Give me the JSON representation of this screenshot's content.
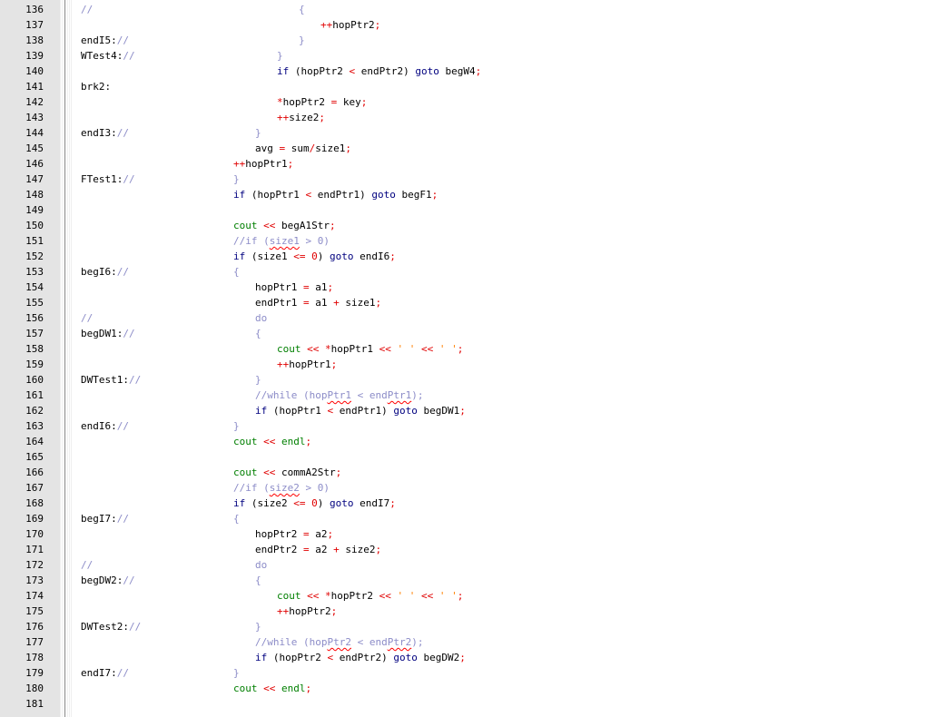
{
  "colors": {
    "keyword": "#00007f",
    "identifier": "#000000",
    "operator": "#e00000",
    "comment": "#8c8cc8",
    "string": "#ff8000",
    "type": "#007f00",
    "linenumber": "#000000"
  },
  "lines": [
    {
      "n": "136",
      "label": [
        {
          "t": "//",
          "c": "comment"
        }
      ],
      "indent": 10,
      "code": [
        {
          "t": "{",
          "c": "comment"
        }
      ]
    },
    {
      "n": "137",
      "label": [],
      "indent": 11,
      "code": [
        {
          "t": "++",
          "c": "operator"
        },
        {
          "t": "hopPtr2",
          "c": "identifier"
        },
        {
          "t": ";",
          "c": "operator"
        }
      ]
    },
    {
      "n": "138",
      "label": [
        {
          "t": "endI5:",
          "c": "identifier"
        },
        {
          "t": "//",
          "c": "comment"
        }
      ],
      "indent": 10,
      "code": [
        {
          "t": "}",
          "c": "comment"
        }
      ]
    },
    {
      "n": "139",
      "label": [
        {
          "t": "WTest4:",
          "c": "identifier"
        },
        {
          "t": "//",
          "c": "comment"
        }
      ],
      "indent": 9,
      "code": [
        {
          "t": "}",
          "c": "comment"
        }
      ]
    },
    {
      "n": "140",
      "label": [],
      "indent": 9,
      "code": [
        {
          "t": "if",
          "c": "keyword"
        },
        {
          "t": " (hopPtr2 ",
          "c": "identifier"
        },
        {
          "t": "<",
          "c": "operator"
        },
        {
          "t": " endPtr2) ",
          "c": "identifier"
        },
        {
          "t": "goto",
          "c": "keyword"
        },
        {
          "t": " begW4",
          "c": "identifier"
        },
        {
          "t": ";",
          "c": "operator"
        }
      ]
    },
    {
      "n": "141",
      "label": [
        {
          "t": "brk2:",
          "c": "identifier"
        }
      ],
      "indent": 9,
      "code": []
    },
    {
      "n": "142",
      "label": [],
      "indent": 9,
      "code": [
        {
          "t": "*",
          "c": "operator"
        },
        {
          "t": "hopPtr2 ",
          "c": "identifier"
        },
        {
          "t": "=",
          "c": "operator"
        },
        {
          "t": " key",
          "c": "identifier"
        },
        {
          "t": ";",
          "c": "operator"
        }
      ]
    },
    {
      "n": "143",
      "label": [],
      "indent": 9,
      "code": [
        {
          "t": "++",
          "c": "operator"
        },
        {
          "t": "size2",
          "c": "identifier"
        },
        {
          "t": ";",
          "c": "operator"
        }
      ]
    },
    {
      "n": "144",
      "label": [
        {
          "t": "endI3:",
          "c": "identifier"
        },
        {
          "t": "//",
          "c": "comment"
        }
      ],
      "indent": 8,
      "code": [
        {
          "t": "}",
          "c": "comment"
        }
      ]
    },
    {
      "n": "145",
      "label": [],
      "indent": 8,
      "code": [
        {
          "t": "avg ",
          "c": "identifier"
        },
        {
          "t": "=",
          "c": "operator"
        },
        {
          "t": " sum",
          "c": "identifier"
        },
        {
          "t": "/",
          "c": "operator"
        },
        {
          "t": "size1",
          "c": "identifier"
        },
        {
          "t": ";",
          "c": "operator"
        }
      ]
    },
    {
      "n": "146",
      "label": [],
      "indent": 7,
      "code": [
        {
          "t": "++",
          "c": "operator"
        },
        {
          "t": "hopPtr1",
          "c": "identifier"
        },
        {
          "t": ";",
          "c": "operator"
        }
      ]
    },
    {
      "n": "147",
      "label": [
        {
          "t": "FTest1:",
          "c": "identifier"
        },
        {
          "t": "//",
          "c": "comment"
        }
      ],
      "indent": 7,
      "code": [
        {
          "t": "}",
          "c": "comment"
        }
      ]
    },
    {
      "n": "148",
      "label": [],
      "indent": 7,
      "code": [
        {
          "t": "if",
          "c": "keyword"
        },
        {
          "t": " (hopPtr1 ",
          "c": "identifier"
        },
        {
          "t": "<",
          "c": "operator"
        },
        {
          "t": " endPtr1) ",
          "c": "identifier"
        },
        {
          "t": "goto",
          "c": "keyword"
        },
        {
          "t": " begF1",
          "c": "identifier"
        },
        {
          "t": ";",
          "c": "operator"
        }
      ]
    },
    {
      "n": "149",
      "label": [],
      "indent": 7,
      "code": []
    },
    {
      "n": "150",
      "label": [],
      "indent": 7,
      "code": [
        {
          "t": "cout",
          "c": "type"
        },
        {
          "t": " ",
          "c": "identifier"
        },
        {
          "t": "<<",
          "c": "operator"
        },
        {
          "t": " begA1Str",
          "c": "identifier"
        },
        {
          "t": ";",
          "c": "operator"
        }
      ]
    },
    {
      "n": "151",
      "label": [],
      "indent": 7,
      "code": [
        {
          "t": "//if (",
          "c": "comment"
        },
        {
          "t": "size1",
          "c": "comment",
          "sq": true
        },
        {
          "t": " > 0)",
          "c": "comment"
        }
      ]
    },
    {
      "n": "152",
      "label": [],
      "indent": 7,
      "code": [
        {
          "t": "if",
          "c": "keyword"
        },
        {
          "t": " (size1 ",
          "c": "identifier"
        },
        {
          "t": "<=",
          "c": "operator"
        },
        {
          "t": " ",
          "c": "identifier"
        },
        {
          "t": "0",
          "c": "operator"
        },
        {
          "t": ") ",
          "c": "identifier"
        },
        {
          "t": "goto",
          "c": "keyword"
        },
        {
          "t": " endI6",
          "c": "identifier"
        },
        {
          "t": ";",
          "c": "operator"
        }
      ]
    },
    {
      "n": "153",
      "label": [
        {
          "t": "begI6:",
          "c": "identifier"
        },
        {
          "t": "//",
          "c": "comment"
        }
      ],
      "indent": 7,
      "code": [
        {
          "t": "{",
          "c": "comment"
        }
      ]
    },
    {
      "n": "154",
      "label": [],
      "indent": 8,
      "code": [
        {
          "t": "hopPtr1 ",
          "c": "identifier"
        },
        {
          "t": "=",
          "c": "operator"
        },
        {
          "t": " a1",
          "c": "identifier"
        },
        {
          "t": ";",
          "c": "operator"
        }
      ]
    },
    {
      "n": "155",
      "label": [],
      "indent": 8,
      "code": [
        {
          "t": "endPtr1 ",
          "c": "identifier"
        },
        {
          "t": "=",
          "c": "operator"
        },
        {
          "t": " a1 ",
          "c": "identifier"
        },
        {
          "t": "+",
          "c": "operator"
        },
        {
          "t": " size1",
          "c": "identifier"
        },
        {
          "t": ";",
          "c": "operator"
        }
      ]
    },
    {
      "n": "156",
      "label": [
        {
          "t": "//",
          "c": "comment"
        }
      ],
      "indent": 8,
      "code": [
        {
          "t": "do",
          "c": "comment"
        }
      ]
    },
    {
      "n": "157",
      "label": [
        {
          "t": "begDW1:",
          "c": "identifier"
        },
        {
          "t": "//",
          "c": "comment"
        }
      ],
      "indent": 8,
      "code": [
        {
          "t": "{",
          "c": "comment"
        }
      ]
    },
    {
      "n": "158",
      "label": [],
      "indent": 9,
      "code": [
        {
          "t": "cout",
          "c": "type"
        },
        {
          "t": " ",
          "c": "identifier"
        },
        {
          "t": "<<",
          "c": "operator"
        },
        {
          "t": " ",
          "c": "identifier"
        },
        {
          "t": "*",
          "c": "operator"
        },
        {
          "t": "hopPtr1 ",
          "c": "identifier"
        },
        {
          "t": "<<",
          "c": "operator"
        },
        {
          "t": " ",
          "c": "identifier"
        },
        {
          "t": "' '",
          "c": "string"
        },
        {
          "t": " ",
          "c": "identifier"
        },
        {
          "t": "<<",
          "c": "operator"
        },
        {
          "t": " ",
          "c": "identifier"
        },
        {
          "t": "' '",
          "c": "string"
        },
        {
          "t": ";",
          "c": "operator"
        }
      ]
    },
    {
      "n": "159",
      "label": [],
      "indent": 9,
      "code": [
        {
          "t": "++",
          "c": "operator"
        },
        {
          "t": "hopPtr1",
          "c": "identifier"
        },
        {
          "t": ";",
          "c": "operator"
        }
      ]
    },
    {
      "n": "160",
      "label": [
        {
          "t": "DWTest1:",
          "c": "identifier"
        },
        {
          "t": "//",
          "c": "comment"
        }
      ],
      "indent": 8,
      "code": [
        {
          "t": "}",
          "c": "comment"
        }
      ]
    },
    {
      "n": "161",
      "label": [],
      "indent": 8,
      "code": [
        {
          "t": "//while (hop",
          "c": "comment"
        },
        {
          "t": "Ptr1",
          "c": "comment",
          "sq": true
        },
        {
          "t": " < end",
          "c": "comment"
        },
        {
          "t": "Ptr1",
          "c": "comment",
          "sq": true
        },
        {
          "t": ");",
          "c": "comment"
        }
      ]
    },
    {
      "n": "162",
      "label": [],
      "indent": 8,
      "code": [
        {
          "t": "if",
          "c": "keyword"
        },
        {
          "t": " (hopPtr1 ",
          "c": "identifier"
        },
        {
          "t": "<",
          "c": "operator"
        },
        {
          "t": " endPtr1) ",
          "c": "identifier"
        },
        {
          "t": "goto",
          "c": "keyword"
        },
        {
          "t": " begDW1",
          "c": "identifier"
        },
        {
          "t": ";",
          "c": "operator"
        }
      ]
    },
    {
      "n": "163",
      "label": [
        {
          "t": "endI6:",
          "c": "identifier"
        },
        {
          "t": "//",
          "c": "comment"
        }
      ],
      "indent": 7,
      "code": [
        {
          "t": "}",
          "c": "comment"
        }
      ]
    },
    {
      "n": "164",
      "label": [],
      "indent": 7,
      "code": [
        {
          "t": "cout",
          "c": "type"
        },
        {
          "t": " ",
          "c": "identifier"
        },
        {
          "t": "<<",
          "c": "operator"
        },
        {
          "t": " endl",
          "c": "type"
        },
        {
          "t": ";",
          "c": "operator"
        }
      ]
    },
    {
      "n": "165",
      "label": [],
      "indent": 7,
      "code": []
    },
    {
      "n": "166",
      "label": [],
      "indent": 7,
      "code": [
        {
          "t": "cout",
          "c": "type"
        },
        {
          "t": " ",
          "c": "identifier"
        },
        {
          "t": "<<",
          "c": "operator"
        },
        {
          "t": " commA2Str",
          "c": "identifier"
        },
        {
          "t": ";",
          "c": "operator"
        }
      ]
    },
    {
      "n": "167",
      "label": [],
      "indent": 7,
      "code": [
        {
          "t": "//if (",
          "c": "comment"
        },
        {
          "t": "size2",
          "c": "comment",
          "sq": true
        },
        {
          "t": " > 0)",
          "c": "comment"
        }
      ]
    },
    {
      "n": "168",
      "label": [],
      "indent": 7,
      "code": [
        {
          "t": "if",
          "c": "keyword"
        },
        {
          "t": " (size2 ",
          "c": "identifier"
        },
        {
          "t": "<=",
          "c": "operator"
        },
        {
          "t": " ",
          "c": "identifier"
        },
        {
          "t": "0",
          "c": "operator"
        },
        {
          "t": ") ",
          "c": "identifier"
        },
        {
          "t": "goto",
          "c": "keyword"
        },
        {
          "t": " endI7",
          "c": "identifier"
        },
        {
          "t": ";",
          "c": "operator"
        }
      ]
    },
    {
      "n": "169",
      "label": [
        {
          "t": "begI7:",
          "c": "identifier"
        },
        {
          "t": "//",
          "c": "comment"
        }
      ],
      "indent": 7,
      "code": [
        {
          "t": "{",
          "c": "comment"
        }
      ]
    },
    {
      "n": "170",
      "label": [],
      "indent": 8,
      "code": [
        {
          "t": "hopPtr2 ",
          "c": "identifier"
        },
        {
          "t": "=",
          "c": "operator"
        },
        {
          "t": " a2",
          "c": "identifier"
        },
        {
          "t": ";",
          "c": "operator"
        }
      ]
    },
    {
      "n": "171",
      "label": [],
      "indent": 8,
      "code": [
        {
          "t": "endPtr2 ",
          "c": "identifier"
        },
        {
          "t": "=",
          "c": "operator"
        },
        {
          "t": " a2 ",
          "c": "identifier"
        },
        {
          "t": "+",
          "c": "operator"
        },
        {
          "t": " size2",
          "c": "identifier"
        },
        {
          "t": ";",
          "c": "operator"
        }
      ]
    },
    {
      "n": "172",
      "label": [
        {
          "t": "//",
          "c": "comment"
        }
      ],
      "indent": 8,
      "code": [
        {
          "t": "do",
          "c": "comment"
        }
      ]
    },
    {
      "n": "173",
      "label": [
        {
          "t": "begDW2:",
          "c": "identifier"
        },
        {
          "t": "//",
          "c": "comment"
        }
      ],
      "indent": 8,
      "code": [
        {
          "t": "{",
          "c": "comment"
        }
      ]
    },
    {
      "n": "174",
      "label": [],
      "indent": 9,
      "code": [
        {
          "t": "cout",
          "c": "type"
        },
        {
          "t": " ",
          "c": "identifier"
        },
        {
          "t": "<<",
          "c": "operator"
        },
        {
          "t": " ",
          "c": "identifier"
        },
        {
          "t": "*",
          "c": "operator"
        },
        {
          "t": "hopPtr2 ",
          "c": "identifier"
        },
        {
          "t": "<<",
          "c": "operator"
        },
        {
          "t": " ",
          "c": "identifier"
        },
        {
          "t": "' '",
          "c": "string"
        },
        {
          "t": " ",
          "c": "identifier"
        },
        {
          "t": "<<",
          "c": "operator"
        },
        {
          "t": " ",
          "c": "identifier"
        },
        {
          "t": "' '",
          "c": "string"
        },
        {
          "t": ";",
          "c": "operator"
        }
      ]
    },
    {
      "n": "175",
      "label": [],
      "indent": 9,
      "code": [
        {
          "t": "++",
          "c": "operator"
        },
        {
          "t": "hopPtr2",
          "c": "identifier"
        },
        {
          "t": ";",
          "c": "operator"
        }
      ]
    },
    {
      "n": "176",
      "label": [
        {
          "t": "DWTest2:",
          "c": "identifier"
        },
        {
          "t": "//",
          "c": "comment"
        }
      ],
      "indent": 8,
      "code": [
        {
          "t": "}",
          "c": "comment"
        }
      ]
    },
    {
      "n": "177",
      "label": [],
      "indent": 8,
      "code": [
        {
          "t": "//while (hop",
          "c": "comment"
        },
        {
          "t": "Ptr2",
          "c": "comment",
          "sq": true
        },
        {
          "t": " < end",
          "c": "comment"
        },
        {
          "t": "Ptr2",
          "c": "comment",
          "sq": true
        },
        {
          "t": ");",
          "c": "comment"
        }
      ]
    },
    {
      "n": "178",
      "label": [],
      "indent": 8,
      "code": [
        {
          "t": "if",
          "c": "keyword"
        },
        {
          "t": " (hopPtr2 ",
          "c": "identifier"
        },
        {
          "t": "<",
          "c": "operator"
        },
        {
          "t": " endPtr2) ",
          "c": "identifier"
        },
        {
          "t": "goto",
          "c": "keyword"
        },
        {
          "t": " begDW2",
          "c": "identifier"
        },
        {
          "t": ";",
          "c": "operator"
        }
      ]
    },
    {
      "n": "179",
      "label": [
        {
          "t": "endI7:",
          "c": "identifier"
        },
        {
          "t": "//",
          "c": "comment"
        }
      ],
      "indent": 7,
      "code": [
        {
          "t": "}",
          "c": "comment"
        }
      ]
    },
    {
      "n": "180",
      "label": [],
      "indent": 7,
      "code": [
        {
          "t": "cout",
          "c": "type"
        },
        {
          "t": " ",
          "c": "identifier"
        },
        {
          "t": "<<",
          "c": "operator"
        },
        {
          "t": " endl",
          "c": "type"
        },
        {
          "t": ";",
          "c": "operator"
        }
      ]
    },
    {
      "n": "181",
      "label": [],
      "indent": 7,
      "code": []
    }
  ]
}
